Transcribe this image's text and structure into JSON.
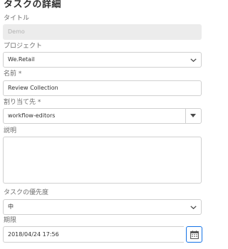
{
  "page": {
    "title": "タスクの詳細"
  },
  "fields": {
    "title": {
      "label": "タイトル",
      "value": "Demo"
    },
    "project": {
      "label": "プロジェクト",
      "value": "We.Retail"
    },
    "name": {
      "label": "名前 *",
      "value": "Review Collection"
    },
    "assignee": {
      "label": "割り当て先 *",
      "value": "workflow-editors"
    },
    "description": {
      "label": "説明",
      "value": ""
    },
    "priority": {
      "label": "タスクの優先度",
      "value": "中"
    },
    "due_date": {
      "label": "期限",
      "value": "2018/04/24 17:56"
    }
  },
  "icons": {
    "project_toggle": "chevron-down-icon",
    "assignee_toggle": "caret-down-icon",
    "priority_toggle": "chevron-down-icon",
    "date_picker": "calendar-icon"
  },
  "colors": {
    "accent": "#1473e6",
    "border": "#d0d0d0",
    "disabled_background": "#ececec",
    "label_text": "#6e6e6e"
  }
}
